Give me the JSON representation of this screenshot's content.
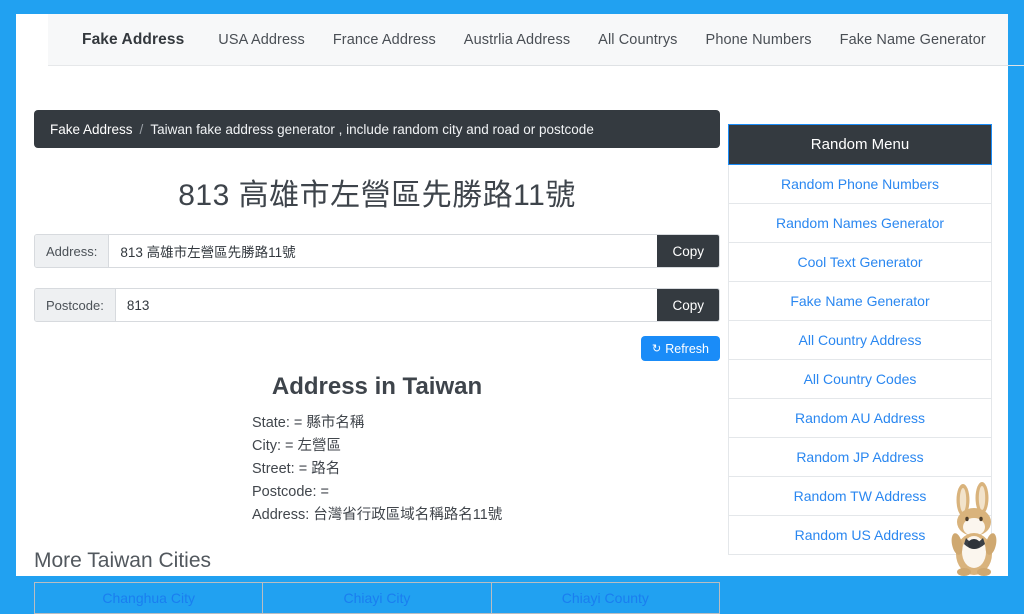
{
  "theme": {
    "frame_blue": "#21a1f1",
    "dark": "#343a40",
    "link_blue": "#2a87f0",
    "button_blue": "#1a8cf8"
  },
  "nav": {
    "brand": "Fake Address",
    "items": [
      {
        "label": "USA Address"
      },
      {
        "label": "France Address"
      },
      {
        "label": "Austrlia Address"
      },
      {
        "label": "All Countrys"
      },
      {
        "label": "Phone Numbers"
      },
      {
        "label": "Fake Name Generator"
      }
    ]
  },
  "breadcrumb": {
    "home": "Fake Address",
    "separator": "/",
    "current": "Taiwan fake address generator , include random city and road or postcode"
  },
  "page_title": "813 高雄市左營區先勝路11號",
  "fields": {
    "address": {
      "label": "Address:",
      "value": "813 高雄市左營區先勝路11號",
      "copy_label": "Copy"
    },
    "postcode": {
      "label": "Postcode:",
      "value": "813",
      "copy_label": "Copy"
    }
  },
  "refresh": {
    "glyph": "↻",
    "label": "Refresh"
  },
  "details": {
    "title": "Address in Taiwan",
    "lines": [
      "State: = 縣市名稱",
      "City: = 左營區",
      "Street: = 路名",
      "Postcode: =",
      "Address: 台灣省行政區域名稱路名11號"
    ]
  },
  "more_cities": {
    "title": "More Taiwan Cities",
    "rows": [
      [
        "Changhua City",
        "Chiayi City",
        "Chiayi County"
      ]
    ]
  },
  "sidebar": {
    "header": "Random Menu",
    "items": [
      {
        "label": "Random Phone Numbers"
      },
      {
        "label": "Random Names Generator"
      },
      {
        "label": "Cool Text Generator"
      },
      {
        "label": "Fake Name Generator"
      },
      {
        "label": "All Country Address"
      },
      {
        "label": "All Country Codes"
      },
      {
        "label": "Random AU Address"
      },
      {
        "label": "Random JP Address"
      },
      {
        "label": "Random TW Address"
      },
      {
        "label": "Random US Address"
      }
    ]
  },
  "mascot": {
    "name": "rabbit"
  }
}
